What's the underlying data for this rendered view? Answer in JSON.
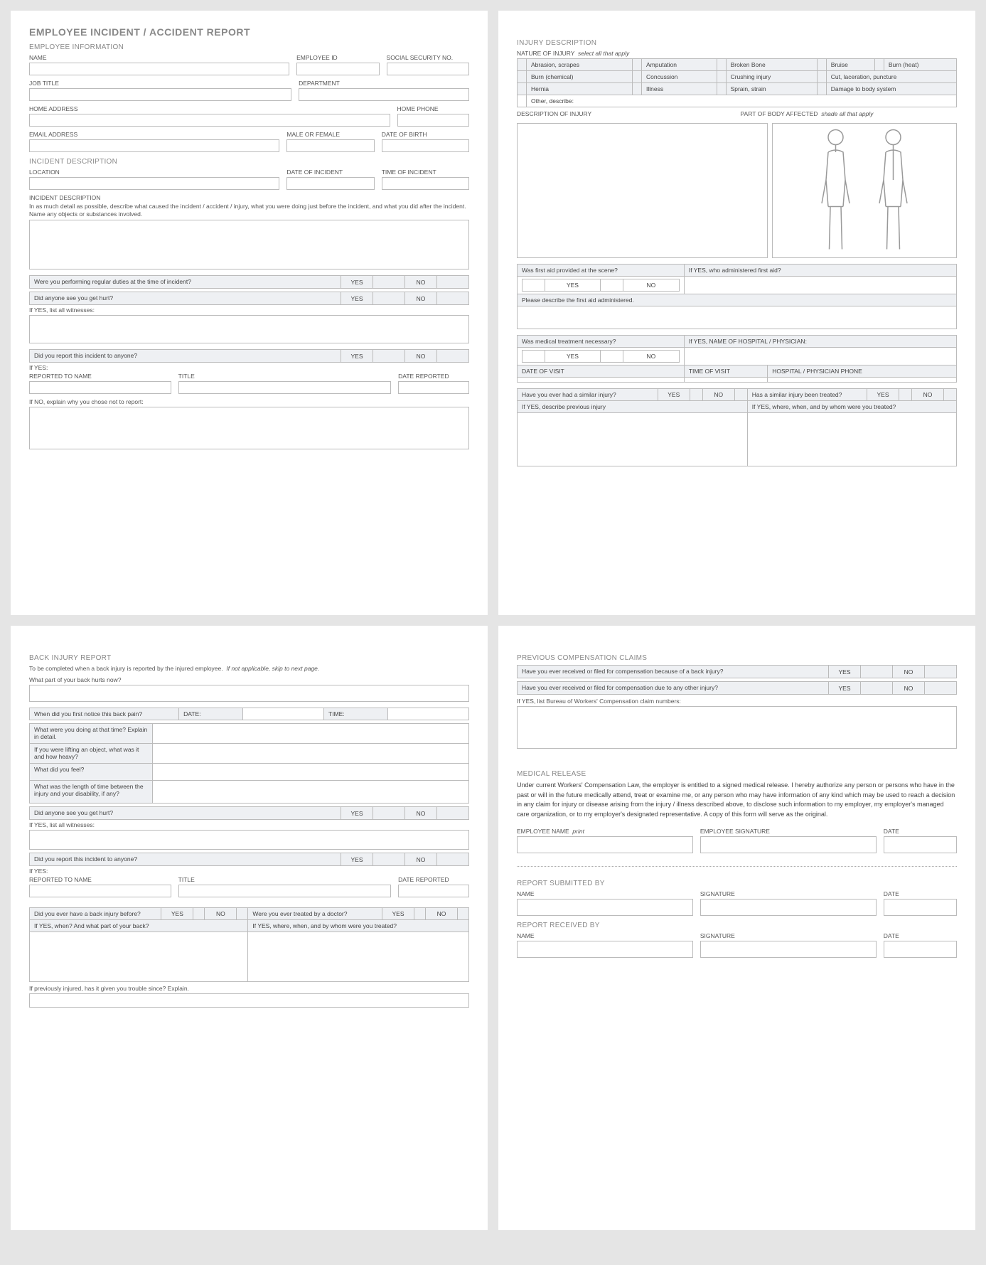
{
  "pageTitle": "EMPLOYEE INCIDENT / ACCIDENT REPORT",
  "emp": {
    "section": "EMPLOYEE INFORMATION",
    "name": "NAME",
    "empid": "EMPLOYEE ID",
    "ssn": "SOCIAL SECURITY NO.",
    "jobtitle": "JOB TITLE",
    "dept": "DEPARTMENT",
    "homeaddr": "HOME ADDRESS",
    "homephone": "HOME PHONE",
    "email": "EMAIL ADDRESS",
    "sex": "MALE OR FEMALE",
    "dob": "DATE OF BIRTH"
  },
  "inc": {
    "section": "INCIDENT DESCRIPTION",
    "loc": "LOCATION",
    "doi": "DATE OF INCIDENT",
    "toi": "TIME OF INCIDENT",
    "descHdr": "INCIDENT DESCRIPTION",
    "descTxt": "In as much detail as possible, describe what caused the incident / accident / injury, what you were doing just before the incident, and what you did after the incident.  Name any objects or substances involved.",
    "q1": "Were you performing regular duties at the time of incident?",
    "q2": "Did anyone see you get hurt?",
    "wit": "If YES, list all witnesses:",
    "q3": "Did you report this incident to anyone?",
    "ifyes": "If YES:",
    "repname": "REPORTED TO NAME",
    "title": "TITLE",
    "daterep": "DATE REPORTED",
    "ifno": "If NO, explain why you chose not to report:"
  },
  "yes": "YES",
  "no": "NO",
  "date": "DATE:",
  "time": "TIME:",
  "inj": {
    "section": "INJURY DESCRIPTION",
    "nature": "NATURE OF INJURY",
    "natureItalic": "select all that apply",
    "opts": [
      "Abrasion, scrapes",
      "Amputation",
      "Broken Bone",
      "Bruise",
      "Burn (heat)",
      "Burn (chemical)",
      "Concussion",
      "Crushing injury",
      "Cut, laceration, puncture",
      "Hernia",
      "Illness",
      "Sprain, strain",
      "Damage to body system",
      "Other, describe:"
    ],
    "descInj": "DESCRIPTION OF INJURY",
    "bodyPart": "PART OF BODY AFFECTED",
    "bodyItalic": "shade all that apply",
    "fa1": "Was first aid provided at the scene?",
    "fa2": "If YES, who administered first aid?",
    "fa3": "Please describe the first aid administered.",
    "mt1": "Was medical treatment necessary?",
    "mt2": "If YES, NAME OF HOSPITAL / PHYSICIAN:",
    "dov": "DATE OF VISIT",
    "tov": "TIME OF VISIT",
    "hphone": "HOSPITAL / PHYSICIAN PHONE",
    "si1": "Have you ever had a similar injury?",
    "si2": "Has a similar injury been treated?",
    "si3": "If YES, describe previous injury",
    "si4": "If YES, where, when, and by whom were you treated?"
  },
  "back": {
    "section": "BACK INJURY REPORT",
    "sub": "To be completed when a back injury is reported by the injured employee.",
    "subItalic": "If not applicable, skip to next page.",
    "q1": "What part of your back hurts now?",
    "q2": "When did you first notice this back pain?",
    "q3": "What were you doing at that time?  Explain in detail.",
    "q4": "If you were lifting an object, what was it and how heavy?",
    "q5": "What did you feel?",
    "q6": "What was the length of time between the injury and your disability, if any?",
    "q7": "Did anyone see you get hurt?",
    "wit": "If YES, list all witnesses:",
    "q8": "Did you report this incident to anyone?",
    "ifyes": "If YES:",
    "repname": "REPORTED TO NAME",
    "title": "TITLE",
    "daterep": "DATE REPORTED",
    "q9": "Did you ever have a back injury before?",
    "q10": "Were you ever treated by a doctor?",
    "q11": "If YES, when? And what part of your back?",
    "q12": "If YES, where, when, and by whom were you treated?",
    "q13": "If previously injured, has it given you trouble since?  Explain."
  },
  "comp": {
    "section": "PREVIOUS COMPENSATION CLAIMS",
    "q1": "Have you ever received or filed for compensation because of a back injury?",
    "q2": "Have you ever received or filed for compensation due to any other injury?",
    "q3": "If YES, list Bureau of Workers' Compensation claim numbers:"
  },
  "rel": {
    "section": "MEDICAL RELEASE",
    "para": "Under current Workers' Compensation Law, the employer is entitled to a signed medical release.  I hereby authorize any person or persons who have in the past or will in the future medically attend, treat or examine me, or any person who may have information of any kind which may be used to reach a decision in any claim for injury or disease arising from the injury / illness described above, to disclose such information to my employer, my employer's managed care organization, or to my employer's designated representative.  A copy of this form will serve as the original.",
    "empname": "EMPLOYEE NAME",
    "print": "print",
    "empsig": "EMPLOYEE SIGNATURE",
    "date": "DATE"
  },
  "sub": {
    "s1": "REPORT SUBMITTED BY",
    "s2": "REPORT RECEIVED BY",
    "name": "NAME",
    "sig": "SIGNATURE",
    "date": "DATE"
  }
}
